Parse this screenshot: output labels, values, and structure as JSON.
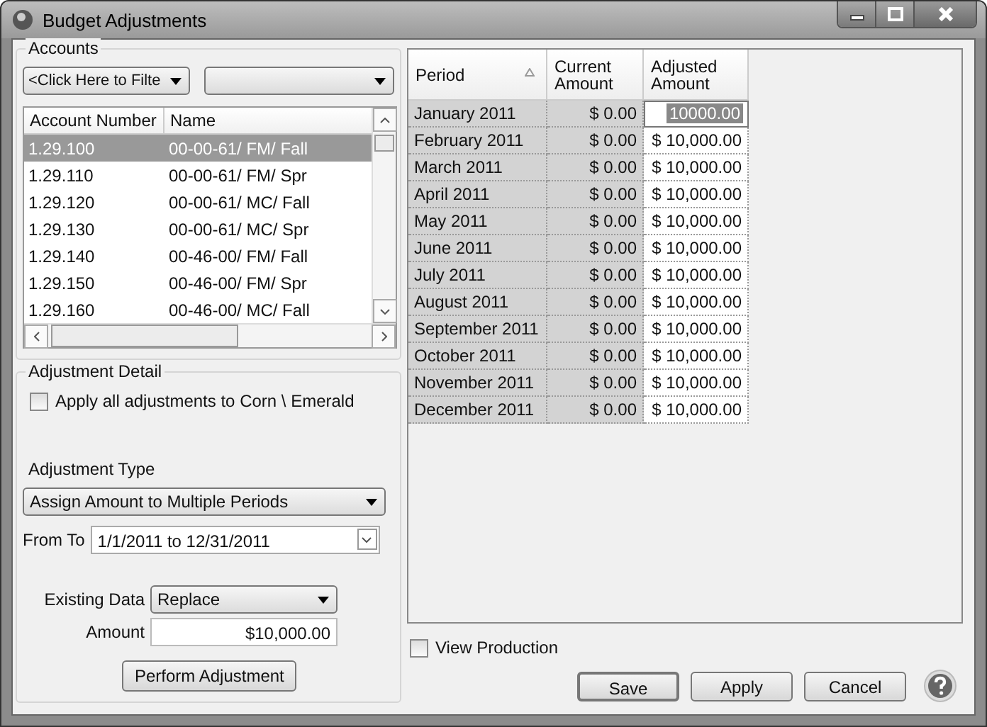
{
  "window": {
    "title": "Budget Adjustments"
  },
  "accounts": {
    "title": "Accounts",
    "filter": {
      "value": "<Click Here to Filte"
    },
    "columns": [
      "Account Number",
      "Name"
    ],
    "rows": [
      {
        "number": "1.29.100",
        "name": "00-00-61/ FM/ Fall",
        "selected": true
      },
      {
        "number": "1.29.110",
        "name": "00-00-61/ FM/ Spr",
        "selected": false
      },
      {
        "number": "1.29.120",
        "name": "00-00-61/ MC/ Fall",
        "selected": false
      },
      {
        "number": "1.29.130",
        "name": "00-00-61/ MC/ Spr",
        "selected": false
      },
      {
        "number": "1.29.140",
        "name": "00-46-00/ FM/ Fall",
        "selected": false
      },
      {
        "number": "1.29.150",
        "name": "00-46-00/ FM/ Spr",
        "selected": false
      },
      {
        "number": "1.29.160",
        "name": "00-46-00/ MC/ Fall",
        "selected": false
      }
    ]
  },
  "detail": {
    "title": "Adjustment Detail",
    "apply_all": {
      "label": "Apply all adjustments to Corn \\ Emerald",
      "checked": false
    },
    "type_label": "Adjustment Type",
    "type_value": "Assign Amount to Multiple Periods",
    "from_to_label": "From To",
    "from_to_value": "1/1/2011 to 12/31/2011",
    "existing_label": "Existing Data",
    "existing_value": "Replace",
    "amount_label": "Amount",
    "amount_value": "$10,000.00",
    "perform_button": "Perform Adjustment"
  },
  "grid": {
    "columns": [
      "Period",
      "Current Amount",
      "Adjusted Amount"
    ],
    "rows": [
      {
        "period": "January 2011",
        "current": "$ 0.00",
        "adjusted": "10000.00",
        "editing": true
      },
      {
        "period": "February 2011",
        "current": "$ 0.00",
        "adjusted": "$ 10,000.00",
        "editing": false
      },
      {
        "period": "March 2011",
        "current": "$ 0.00",
        "adjusted": "$ 10,000.00",
        "editing": false
      },
      {
        "period": "April 2011",
        "current": "$ 0.00",
        "adjusted": "$ 10,000.00",
        "editing": false
      },
      {
        "period": "May 2011",
        "current": "$ 0.00",
        "adjusted": "$ 10,000.00",
        "editing": false
      },
      {
        "period": "June 2011",
        "current": "$ 0.00",
        "adjusted": "$ 10,000.00",
        "editing": false
      },
      {
        "period": "July 2011",
        "current": "$ 0.00",
        "adjusted": "$ 10,000.00",
        "editing": false
      },
      {
        "period": "August 2011",
        "current": "$ 0.00",
        "adjusted": "$ 10,000.00",
        "editing": false
      },
      {
        "period": "September 2011",
        "current": "$ 0.00",
        "adjusted": "$ 10,000.00",
        "editing": false
      },
      {
        "period": "October 2011",
        "current": "$ 0.00",
        "adjusted": "$ 10,000.00",
        "editing": false
      },
      {
        "period": "November 2011",
        "current": "$ 0.00",
        "adjusted": "$ 10,000.00",
        "editing": false
      },
      {
        "period": "December 2011",
        "current": "$ 0.00",
        "adjusted": "$ 10,000.00",
        "editing": false
      }
    ]
  },
  "view_production": {
    "label": "View Production",
    "checked": false
  },
  "buttons": [
    "Save",
    "Apply",
    "Cancel"
  ]
}
